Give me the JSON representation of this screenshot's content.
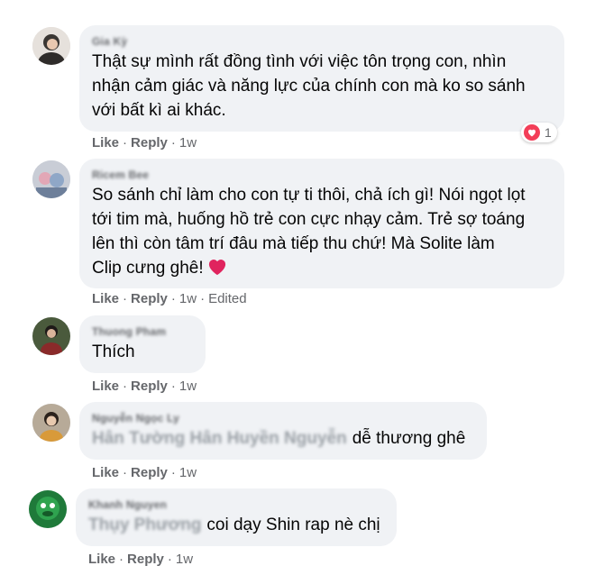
{
  "comments": [
    {
      "author": "Gia Kỳ",
      "lines": [
        "Thật sự mình rất đồng tình với việc tôn trọng con, nhìn",
        "nhận cảm giác và năng lực của chính con mà ko so sánh",
        "với bất kì ai khác."
      ],
      "like": "Like",
      "reply": "Reply",
      "time": "1w",
      "reaction_count": "1",
      "reaction_icon": "heart-reaction-icon"
    },
    {
      "author": "Ricem Bee",
      "lines": [
        "So sánh chỉ làm cho con tự ti thôi, chả ích gì! Nói ngọt lọt",
        "tới tim mà, huống hồ trẻ con cực nhạy cảm. Trẻ sợ toáng",
        "lên thì còn tâm trí đâu mà tiếp thu chứ! Mà Solite làm",
        "Clip cưng ghê!"
      ],
      "emoji": "red-heart-icon",
      "like": "Like",
      "reply": "Reply",
      "time": "1w",
      "edited": "Edited"
    },
    {
      "author": "Thuong Pham",
      "lines": [
        "Thích"
      ],
      "like": "Like",
      "reply": "Reply",
      "time": "1w"
    },
    {
      "author": "Nguyễn Ngọc Ly",
      "mention": "Hân Tường Hân Huyền Nguyễn",
      "text": "dễ thương ghê",
      "like": "Like",
      "reply": "Reply",
      "time": "1w"
    },
    {
      "author": "Khanh Nguyen",
      "mention": "Thụy Phương",
      "text": "coi dạy Shin rap nè chị",
      "like": "Like",
      "reply": "Reply",
      "time": "1w"
    }
  ],
  "separator": "·",
  "colors": {
    "bubble": "#f0f2f5",
    "meta": "#65676b",
    "text": "#050505",
    "heart": "#f33e58"
  }
}
